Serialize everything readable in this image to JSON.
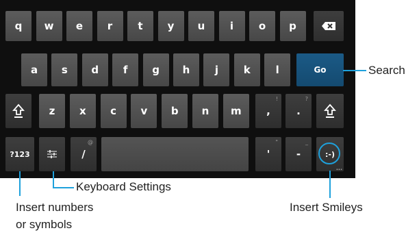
{
  "keyboard": {
    "row1": [
      "q",
      "w",
      "e",
      "r",
      "t",
      "y",
      "u",
      "i",
      "o",
      "p"
    ],
    "row2": [
      "a",
      "s",
      "d",
      "f",
      "g",
      "h",
      "j",
      "k",
      "l"
    ],
    "row3": [
      "z",
      "x",
      "c",
      "v",
      "b",
      "n",
      "m"
    ],
    "go_label": "Go",
    "symbols_label": "?123",
    "slash_label": "/",
    "slash_hint": "@",
    "comma_label": ",",
    "comma_hint": "!",
    "period_label": ".",
    "period_hint": "?",
    "apostrophe_label": "'",
    "apostrophe_hint": "\"",
    "dash_label": "-",
    "dash_hint": "_",
    "smiley_label": ":-)",
    "smiley_hint": "..."
  },
  "callouts": {
    "search": "Search",
    "keyboard_settings": "Keyboard Settings",
    "insert_numbers_line1": "Insert numbers",
    "insert_numbers_line2": "or symbols",
    "insert_smileys": "Insert Smileys"
  },
  "colors": {
    "accent": "#1ea1dc",
    "go_key": "#1b5a86",
    "keyboard_bg": "#0f0f0f"
  }
}
